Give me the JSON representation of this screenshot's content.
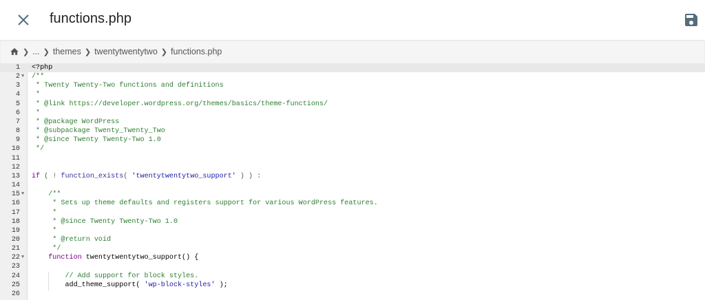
{
  "header": {
    "title": "functions.php",
    "close_icon": "close-icon",
    "save_icon": "save-icon"
  },
  "breadcrumb": {
    "home_icon": "home-icon",
    "items": [
      "...",
      "themes",
      "twentytwentytwo",
      "functions.php"
    ]
  },
  "editor": {
    "active_line": 1,
    "fold_lines": [
      2,
      15,
      22
    ],
    "lines": [
      [
        [
          "df",
          "<?php"
        ]
      ],
      [
        [
          "cm",
          "/**"
        ]
      ],
      [
        [
          "cm",
          " * Twenty Twenty-Two functions and definitions"
        ]
      ],
      [
        [
          "cm",
          " *"
        ]
      ],
      [
        [
          "cm",
          " * @link https://developer.wordpress.org/themes/basics/theme-functions/"
        ]
      ],
      [
        [
          "cm",
          " *"
        ]
      ],
      [
        [
          "cm",
          " * @package WordPress"
        ]
      ],
      [
        [
          "cm",
          " * @subpackage Twenty_Twenty_Two"
        ]
      ],
      [
        [
          "cm",
          " * @since Twenty Twenty-Two 1.0"
        ]
      ],
      [
        [
          "cm",
          " */"
        ]
      ],
      [],
      [],
      [
        [
          "kw",
          "if"
        ],
        [
          "pn",
          " ( ! "
        ],
        [
          "bi",
          "function_exists"
        ],
        [
          "pn",
          "( "
        ],
        [
          "st",
          "'twentytwentytwo_support'"
        ],
        [
          "pn",
          " ) ) :"
        ]
      ],
      [],
      [
        [
          "cm",
          "    /**"
        ]
      ],
      [
        [
          "cm",
          "     * Sets up theme defaults and registers support for various WordPress features."
        ]
      ],
      [
        [
          "cm",
          "     *"
        ]
      ],
      [
        [
          "cm",
          "     * @since Twenty Twenty-Two 1.0"
        ]
      ],
      [
        [
          "cm",
          "     *"
        ]
      ],
      [
        [
          "cm",
          "     * @return void"
        ]
      ],
      [
        [
          "cm",
          "     */"
        ]
      ],
      [
        [
          "kw",
          "    function"
        ],
        [
          "df",
          " twentytwentytwo_support() {"
        ]
      ],
      [],
      [
        [
          "cm",
          "        // Add support for block styles."
        ]
      ],
      [
        [
          "df",
          "        add_theme_support( "
        ],
        [
          "st",
          "'wp-block-styles'"
        ],
        [
          "df",
          " );"
        ]
      ],
      []
    ]
  }
}
